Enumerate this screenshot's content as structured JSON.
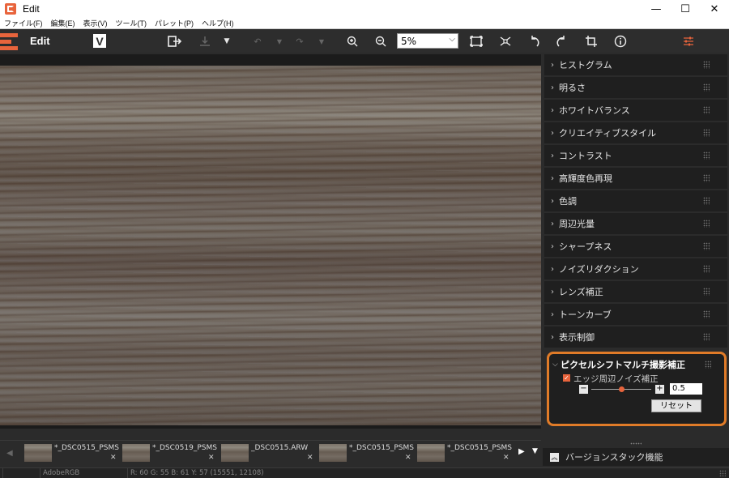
{
  "window": {
    "title": "Edit",
    "minimize": "—",
    "maximize": "☐",
    "close": "✕"
  },
  "menu": [
    "ファイル(F)",
    "編集(E)",
    "表示(V)",
    "ツール(T)",
    "パレット(P)",
    "ヘルプ(H)"
  ],
  "toolbar": {
    "mode_label": "Edit",
    "badge": "V",
    "zoom_value": "5%"
  },
  "palettes": [
    "ヒストグラム",
    "明るさ",
    "ホワイトバランス",
    "クリエイティブスタイル",
    "コントラスト",
    "高輝度色再現",
    "色調",
    "周辺光量",
    "シャープネス",
    "ノイズリダクション",
    "レンズ補正",
    "トーンカーブ",
    "表示制御"
  ],
  "pixel_shift": {
    "title": "ピクセルシフトマルチ撮影補正",
    "checkbox_label": "エッジ周辺ノイズ補正",
    "checked": true,
    "value": "0.5",
    "slider_level": 0.5,
    "reset_label": "リセット"
  },
  "filmstrip": [
    "*_DSC0515_PSMS...",
    "*_DSC0519_PSMS1...",
    "_DSC0515.ARW",
    "*_DSC0515_PSMS ...",
    "*_DSC0515_PSMS ..."
  ],
  "version_stack": {
    "label": "バージョンスタック機能"
  },
  "status": {
    "profile": "AdobeRGB",
    "pixel": "R:  60  G:  55  B:  61  Y:  57     (15551, 12108)"
  },
  "colors": {
    "accent": "#e8643c",
    "highlight_border": "#e07b28"
  }
}
